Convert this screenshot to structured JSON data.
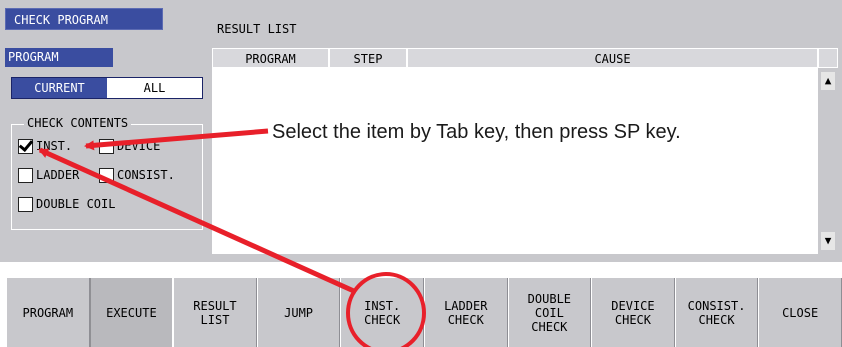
{
  "window": {
    "title": "CHECK PROGRAM"
  },
  "left": {
    "program_label": "PROGRAM",
    "mode": {
      "current": "CURRENT",
      "all": "ALL",
      "selected": "CURRENT"
    },
    "check_contents": {
      "legend": "CHECK CONTENTS",
      "items": [
        {
          "label": "INST.",
          "checked": true
        },
        {
          "label": "DEVICE",
          "checked": false
        },
        {
          "label": "LADDER",
          "checked": false
        },
        {
          "label": "CONSIST.",
          "checked": false
        },
        {
          "label": "DOUBLE COIL",
          "checked": false
        }
      ]
    }
  },
  "result": {
    "label": "RESULT LIST",
    "columns": [
      "PROGRAM",
      "STEP",
      "CAUSE"
    ],
    "scroll_up": "▲",
    "scroll_down": "▼"
  },
  "annotation": {
    "text": "Select the item by Tab key, then press SP key.",
    "color": "#e8202a"
  },
  "function_keys": [
    {
      "label": "PROGRAM"
    },
    {
      "label": "EXECUTE"
    },
    {
      "label": "RESULT\nLIST"
    },
    {
      "label": "JUMP"
    },
    {
      "label": "INST.\nCHECK"
    },
    {
      "label": "LADDER\nCHECK"
    },
    {
      "label": "DOUBLE\nCOIL\nCHECK"
    },
    {
      "label": "DEVICE\nCHECK"
    },
    {
      "label": "CONSIST.\nCHECK"
    },
    {
      "label": "CLOSE"
    }
  ],
  "colors": {
    "accent": "#3a4da0",
    "panel": "#c8c8cc",
    "highlight": "#e8202a"
  }
}
